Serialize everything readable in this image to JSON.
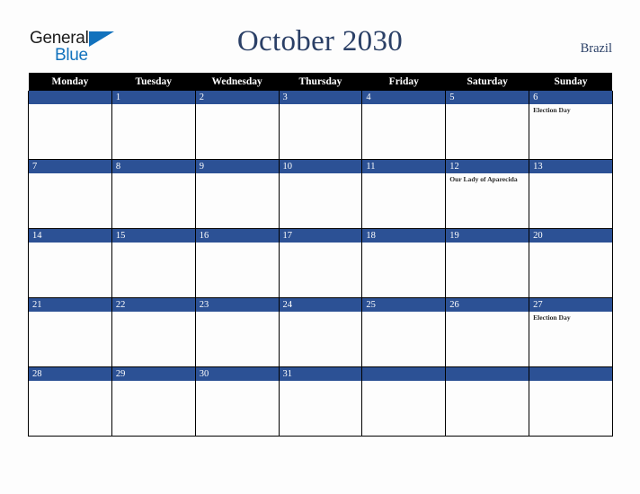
{
  "brand": {
    "name_line1": "General",
    "name_line2": "Blue",
    "triangle_icon": "triangle-icon",
    "color_primary": "#1272bd",
    "color_text": "#1d1d1d"
  },
  "header": {
    "title": "October 2030",
    "month": "October",
    "year": "2030",
    "country": "Brazil",
    "title_color": "#2a3f66"
  },
  "calendar": {
    "weekday_headers": [
      "Monday",
      "Tuesday",
      "Wednesday",
      "Thursday",
      "Friday",
      "Saturday",
      "Sunday"
    ],
    "header_bg": "#000000",
    "header_text_color": "#ffffff",
    "datebar_bg": "#2c5195",
    "datebar_text_color": "#ffffff",
    "cell_bg": "#fdfdfd",
    "border_color": "#000000",
    "weeks": [
      {
        "days": [
          {
            "date": "",
            "events": []
          },
          {
            "date": "1",
            "events": []
          },
          {
            "date": "2",
            "events": []
          },
          {
            "date": "3",
            "events": []
          },
          {
            "date": "4",
            "events": []
          },
          {
            "date": "5",
            "events": []
          },
          {
            "date": "6",
            "events": [
              "Election Day"
            ]
          }
        ]
      },
      {
        "days": [
          {
            "date": "7",
            "events": []
          },
          {
            "date": "8",
            "events": []
          },
          {
            "date": "9",
            "events": []
          },
          {
            "date": "10",
            "events": []
          },
          {
            "date": "11",
            "events": []
          },
          {
            "date": "12",
            "events": [
              "Our Lady of Aparecida"
            ]
          },
          {
            "date": "13",
            "events": []
          }
        ]
      },
      {
        "days": [
          {
            "date": "14",
            "events": []
          },
          {
            "date": "15",
            "events": []
          },
          {
            "date": "16",
            "events": []
          },
          {
            "date": "17",
            "events": []
          },
          {
            "date": "18",
            "events": []
          },
          {
            "date": "19",
            "events": []
          },
          {
            "date": "20",
            "events": []
          }
        ]
      },
      {
        "days": [
          {
            "date": "21",
            "events": []
          },
          {
            "date": "22",
            "events": []
          },
          {
            "date": "23",
            "events": []
          },
          {
            "date": "24",
            "events": []
          },
          {
            "date": "25",
            "events": []
          },
          {
            "date": "26",
            "events": []
          },
          {
            "date": "27",
            "events": [
              "Election Day"
            ]
          }
        ]
      },
      {
        "days": [
          {
            "date": "28",
            "events": []
          },
          {
            "date": "29",
            "events": []
          },
          {
            "date": "30",
            "events": []
          },
          {
            "date": "31",
            "events": []
          },
          {
            "date": "",
            "events": []
          },
          {
            "date": "",
            "events": []
          },
          {
            "date": "",
            "events": []
          }
        ]
      }
    ]
  }
}
